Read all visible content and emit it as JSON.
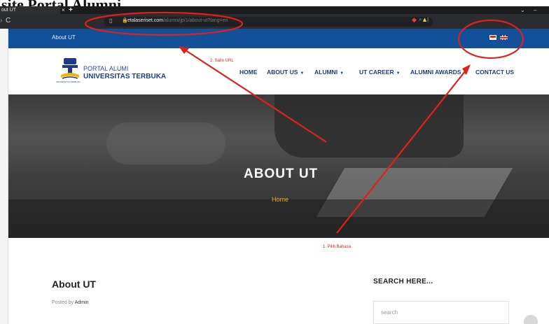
{
  "document": {
    "heading": "site Portal Alumni"
  },
  "browser": {
    "tab_title": "out UT",
    "tab_close": "×",
    "new_tab": "+",
    "window_minimize": "–",
    "window_menu": "⌄",
    "url_host": "etalaseriset.com",
    "url_path": "/alumni/jp/1/about-ut?lang=en",
    "nav_reload": "C"
  },
  "topbar": {
    "page_title": "About UT"
  },
  "logo": {
    "line1": "PORTAL ALUMI",
    "line2": "UNIVERSITAS TERBUKA",
    "caption": "UNIVERSITAS TERBUKA"
  },
  "nav": {
    "items": [
      {
        "label": "HOME",
        "dropdown": false
      },
      {
        "label": "ABOUT US",
        "dropdown": true
      },
      {
        "label": "ALUMNI",
        "dropdown": true
      },
      {
        "label": "UT CAREER",
        "dropdown": true
      },
      {
        "label": "ALUMNI AWARDS",
        "dropdown": true
      },
      {
        "label": "CONTACT US",
        "dropdown": false
      }
    ]
  },
  "hero": {
    "title": "ABOUT UT",
    "breadcrumb": "Home"
  },
  "article": {
    "title": "About UT",
    "meta_prefix": "Posted by",
    "author": "Admin"
  },
  "sidebar": {
    "search_title": "SEARCH HERE...",
    "search_placeholder": "search"
  },
  "annotations": {
    "step1": "1. Pilih Bahasa",
    "step2": "2. Salin URL",
    "color": "#e0201a"
  },
  "colors": {
    "topbar": "#12509a",
    "nav_text": "#1b3c85",
    "breadcrumb": "#f2b705"
  }
}
